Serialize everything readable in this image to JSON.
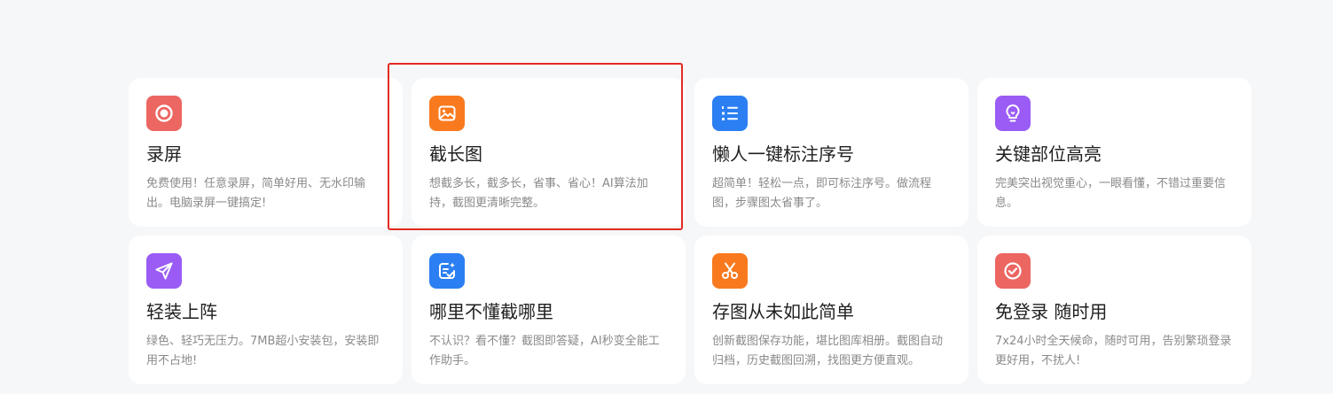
{
  "colors": {
    "page_bg": "#f6f7f9",
    "card_bg": "#ffffff",
    "highlight": "#e42a23"
  },
  "features": [
    {
      "title": "录屏",
      "desc": "免费使用！任意录屏，简单好用、无水印输出。电脑录屏一键搞定!",
      "icon": "record-icon",
      "color": "#ec6662"
    },
    {
      "title": "截长图",
      "desc": "想截多长，截多长，省事、省心！AI算法加持，截图更清晰完整。",
      "icon": "long-screenshot-icon",
      "color": "#f97a1e"
    },
    {
      "title": "懒人一键标注序号",
      "desc": "超简单！轻松一点，即可标注序号。做流程图，步骤图太省事了。",
      "icon": "numbered-list-icon",
      "color": "#2b7ff2"
    },
    {
      "title": "关键部位高亮",
      "desc": "完美突出视觉重心，一眼看懂，不错过重要信息。",
      "icon": "lightbulb-icon",
      "color": "#9a5cf5"
    },
    {
      "title": "轻装上阵",
      "desc": "绿色、轻巧无压力。7MB超小安装包，安装即用不占地!",
      "icon": "paper-plane-icon",
      "color": "#9a5cf5"
    },
    {
      "title": "哪里不懂截哪里",
      "desc": "不认识？看不懂？截图即答疑，AI秒变全能工作助手。",
      "icon": "ai-notes-icon",
      "color": "#2b7ff2"
    },
    {
      "title": "存图从未如此简单",
      "desc": "创新截图保存功能，堪比图库相册。截图自动归档，历史截图回溯，找图更方便直观。",
      "icon": "scissors-icon",
      "color": "#f97a1e"
    },
    {
      "title": "免登录 随时用",
      "desc": "7x24小时全天候命，随时可用，告别繁琐登录更好用，不扰人!",
      "icon": "check-circle-icon",
      "color": "#ec6662"
    }
  ]
}
